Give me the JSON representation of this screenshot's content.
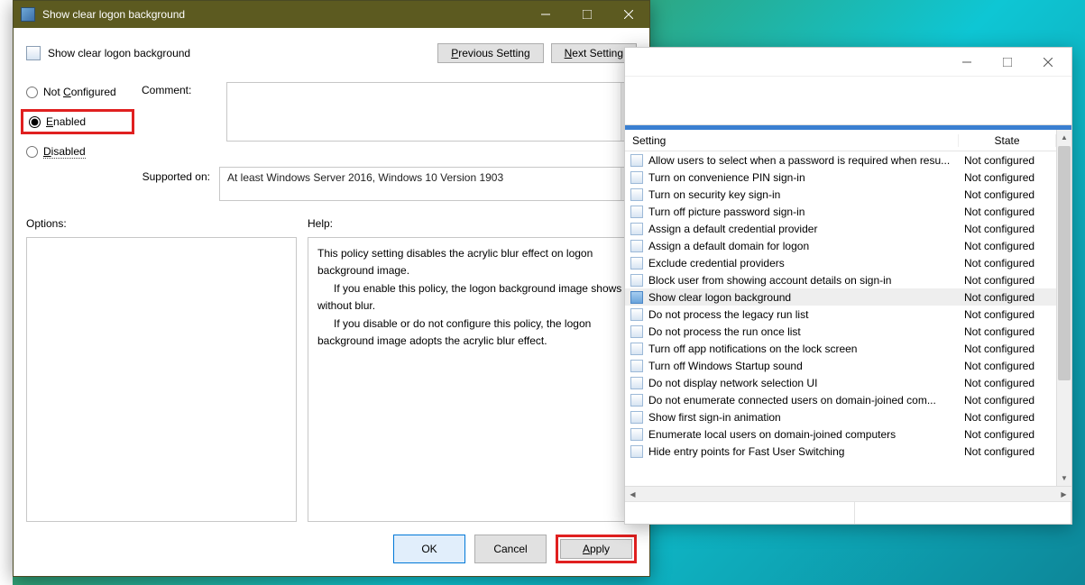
{
  "dlg": {
    "title": "Show clear logon background",
    "heading": "Show clear logon background",
    "nav": {
      "prev": "Previous Setting",
      "next": "Next Setting"
    },
    "radios": {
      "not_configured": "Not Configured",
      "enabled": "Enabled",
      "disabled": "Disabled"
    },
    "labels": {
      "comment": "Comment:",
      "supported": "Supported on:",
      "options": "Options:",
      "help": "Help:"
    },
    "supported_text": "At least Windows Server 2016, Windows 10 Version 1903",
    "help": {
      "p1": "This policy setting disables the acrylic blur effect on logon background image.",
      "p2": "If you enable this policy, the logon background image shows without blur.",
      "p3": "If you disable or do not configure this policy, the logon background image adopts the acrylic blur effect."
    },
    "buttons": {
      "ok": "OK",
      "cancel": "Cancel",
      "apply": "Apply"
    }
  },
  "gp": {
    "columns": {
      "setting": "Setting",
      "state": "State"
    },
    "items": [
      {
        "name": "Allow users to select when a password is required when resu...",
        "state": "Not configured"
      },
      {
        "name": "Turn on convenience PIN sign-in",
        "state": "Not configured"
      },
      {
        "name": "Turn on security key sign-in",
        "state": "Not configured"
      },
      {
        "name": "Turn off picture password sign-in",
        "state": "Not configured"
      },
      {
        "name": "Assign a default credential provider",
        "state": "Not configured"
      },
      {
        "name": "Assign a default domain for logon",
        "state": "Not configured"
      },
      {
        "name": "Exclude credential providers",
        "state": "Not configured"
      },
      {
        "name": "Block user from showing account details on sign-in",
        "state": "Not configured"
      },
      {
        "name": "Show clear logon background",
        "state": "Not configured",
        "selected": true
      },
      {
        "name": "Do not process the legacy run list",
        "state": "Not configured"
      },
      {
        "name": "Do not process the run once list",
        "state": "Not configured"
      },
      {
        "name": "Turn off app notifications on the lock screen",
        "state": "Not configured"
      },
      {
        "name": "Turn off Windows Startup sound",
        "state": "Not configured"
      },
      {
        "name": "Do not display network selection UI",
        "state": "Not configured"
      },
      {
        "name": "Do not enumerate connected users on domain-joined com...",
        "state": "Not configured"
      },
      {
        "name": "Show first sign-in animation",
        "state": "Not configured"
      },
      {
        "name": "Enumerate local users on domain-joined computers",
        "state": "Not configured"
      },
      {
        "name": "Hide entry points for Fast User Switching",
        "state": "Not configured"
      }
    ]
  }
}
